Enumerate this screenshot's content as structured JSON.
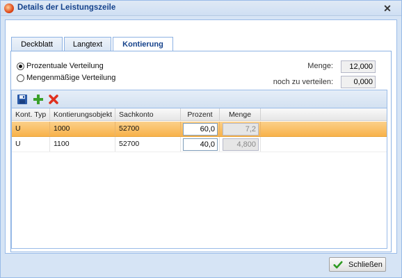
{
  "window": {
    "title": "Details der Leistungszeile"
  },
  "tabs": [
    {
      "label": "Deckblatt",
      "active": false
    },
    {
      "label": "Langtext",
      "active": false
    },
    {
      "label": "Kontierung",
      "active": true
    }
  ],
  "distribution": {
    "options": [
      {
        "label": "Prozentuale Verteilung",
        "checked": true
      },
      {
        "label": "Mengenmäßige Verteilung",
        "checked": false
      }
    ]
  },
  "fields": {
    "menge_label": "Menge:",
    "menge_value": "12,000",
    "noch_label": "noch zu verteilen:",
    "noch_value": "0,000"
  },
  "toolbar": {
    "icons": [
      "save-icon",
      "add-icon",
      "delete-icon"
    ]
  },
  "grid": {
    "columns": [
      "Kont. Typ",
      "Kontierungsobjekt",
      "Sachkonto",
      "Prozent",
      "Menge"
    ],
    "rows": [
      {
        "typ": "U",
        "objekt": "1000",
        "sachkonto": "52700",
        "prozent": "60,0",
        "menge": "7,2",
        "selected": true
      },
      {
        "typ": "U",
        "objekt": "1100",
        "sachkonto": "52700",
        "prozent": "40,0",
        "menge": "4,800",
        "selected": false
      }
    ]
  },
  "footer": {
    "close_label": "Schließen"
  },
  "colors": {
    "selected_row": "#f8b24a",
    "window_border": "#99bbe8",
    "title_text": "#15428b"
  }
}
